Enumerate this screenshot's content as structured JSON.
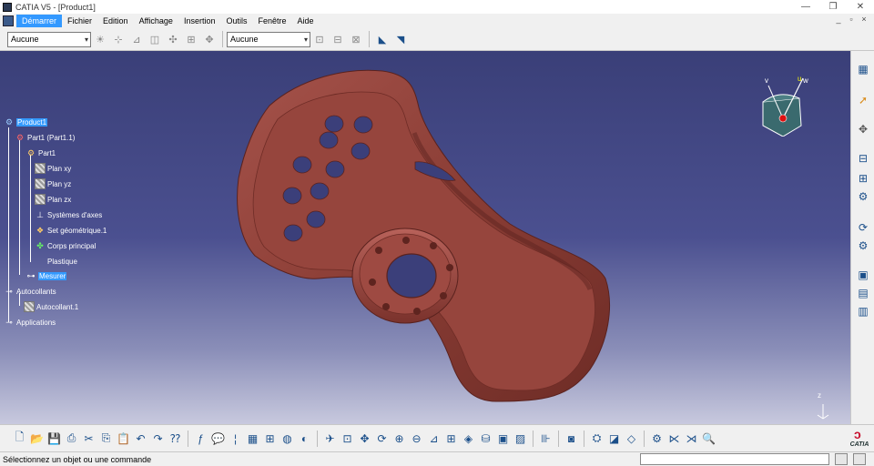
{
  "window": {
    "title": "CATIA V5 - [Product1]",
    "minimize_glyph": "—",
    "restore_glyph": "❐",
    "close_glyph": "✕"
  },
  "menubar": {
    "items": [
      "Démarrer",
      "Fichier",
      "Edition",
      "Affichage",
      "Insertion",
      "Outils",
      "Fenêtre",
      "Aide"
    ],
    "mdi_minimize": "_",
    "mdi_restore": "▫",
    "mdi_close": "×"
  },
  "toolbar_top": {
    "select1_value": "Aucune",
    "select2_value": "Aucune"
  },
  "tree": {
    "rows": [
      {
        "label": "Product1",
        "selected": true
      },
      {
        "label": "Part1 (Part1.1)",
        "selected": false
      },
      {
        "label": "Part1",
        "selected": false
      },
      {
        "label": "Plan xy",
        "selected": false
      },
      {
        "label": "Plan yz",
        "selected": false
      },
      {
        "label": "Plan zx",
        "selected": false
      },
      {
        "label": "Systèmes d'axes",
        "selected": false
      },
      {
        "label": "Set géométrique.1",
        "selected": false
      },
      {
        "label": "Corps principal",
        "selected": false
      },
      {
        "label": "Plastique",
        "selected": false
      },
      {
        "label": "Mesurer",
        "selected": true
      },
      {
        "label": "Autocollants",
        "selected": false
      },
      {
        "label": "Autocollant.1",
        "selected": false
      },
      {
        "label": "Applications",
        "selected": false
      }
    ]
  },
  "compass": {
    "u_label": "u",
    "v_label": "v",
    "w_label": "w"
  },
  "axis_indicator": {
    "z_label": "z"
  },
  "model": {
    "color": "#8a3d35"
  },
  "bottom_toolbar": {
    "logo_text": "CATIA"
  },
  "statusbar": {
    "message": "Sélectionnez un objet ou une commande"
  },
  "icons": {
    "top": [
      "sun-icon",
      "snap-icon",
      "snap-icon",
      "snap-icon",
      "snap-icon",
      "snap-icon",
      "snap-icon",
      "snap-icon"
    ],
    "bottom": [
      "new-file-icon",
      "open-file-icon",
      "save-icon",
      "print-icon",
      "cut-icon",
      "copy-icon",
      "paste-icon",
      "undo-icon",
      "redo-icon",
      "whats-this-icon",
      "formula-icon",
      "comment-icon",
      "law-icon",
      "table-icon",
      "tree-expand-icon",
      "catalog-icon",
      "reference-icon",
      "fly-mode-icon",
      "fit-all-icon",
      "pan-icon",
      "rotate-icon",
      "zoom-in-icon",
      "zoom-out-icon",
      "normal-view-icon",
      "multi-view-icon",
      "iso-view-icon",
      "render-style-icon",
      "hide-show-icon",
      "swap-visible-icon",
      "measure-icon",
      "camera-icon",
      "apply-material-icon",
      "sticker-icon",
      "render-icon",
      "scene-icon",
      "turntable-icon",
      "search-icon"
    ]
  }
}
